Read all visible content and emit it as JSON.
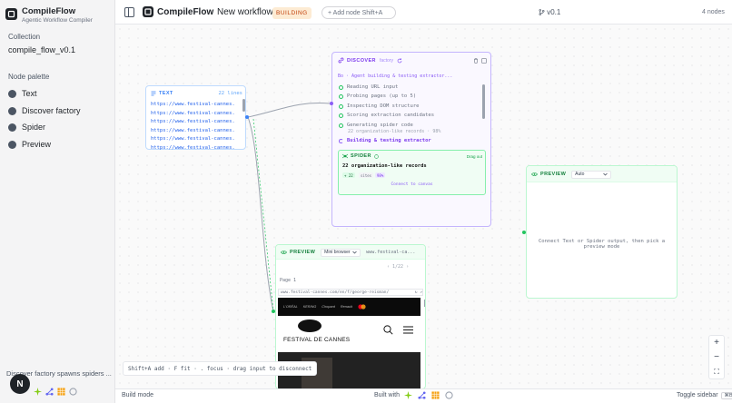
{
  "sidebar": {
    "brand_name": "CompileFlow",
    "brand_sub": "Agentic Workflow Compiler",
    "collection_label": "Collection",
    "collection_name": "compile_flow_v0.1",
    "palette_label": "Node palette",
    "palette": [
      {
        "label": "Text"
      },
      {
        "label": "Discover factory"
      },
      {
        "label": "Spider"
      },
      {
        "label": "Preview"
      }
    ],
    "hint": "Discover factory spawns spiders ...",
    "avatar_letter": "N"
  },
  "topbar": {
    "app_title": "CompileFlow",
    "workflow_name": "New workflow",
    "status": "BUILDING",
    "add_node": "+ Add node  Shift+A",
    "version": "v0.1",
    "node_count": "4 nodes"
  },
  "text_node": {
    "tag": "TEXT",
    "count": "22 lines",
    "urls": [
      "https://www.festival-cannes.c...",
      "https://www.festival-cannes.c...",
      "https://www.festival-cannes.c...",
      "https://www.festival-cannes.c...",
      "https://www.festival-cannes.c...",
      "https://www.festival-cannes.c..."
    ]
  },
  "discover_node": {
    "tag": "DISCOVER",
    "kind": "factory",
    "subtitle": "Bo · Agent building & testing extractor...",
    "steps": [
      "Reading URL input",
      "Probing pages (up to 5)",
      "Inspecting DOM structure",
      "Scoring extraction candidates",
      "Generating spider code"
    ],
    "step_sub": "22 organization-like records · 98%",
    "active_step": "Building & testing extractor",
    "spider": {
      "tag": "SPIDER",
      "drag": "Drag out",
      "title": "22 organization-like records",
      "chips": [
        "+ 22",
        "sites",
        "98%"
      ],
      "connect": "Connect to canvas"
    }
  },
  "preview_right": {
    "tag": "PREVIEW",
    "mode": "Auto",
    "hint": "Connect Text or Spider output, then pick a preview mode"
  },
  "preview_bottom": {
    "tag": "PREVIEW",
    "mode": "Mini browser",
    "url_short": "www.festival-ca...",
    "pager": "1/22",
    "page": "Page 1",
    "address": "www.festival-cannes.com/en/f/george-reisman/",
    "site_name": "FESTIVAL DE CANNES",
    "sponsors": [
      "L'ORÉAL",
      "KERING",
      "Chopard",
      "Renault",
      "Mastercard"
    ]
  },
  "canvas": {
    "hint": "Shift+A add · F fit · . focus · drag input to disconnect"
  },
  "zoom": {
    "plus": "+",
    "minus": "−",
    "fit": "⛶"
  },
  "statusbar": {
    "mode": "Build mode",
    "built_with": "Built with",
    "toggle": "Toggle sidebar",
    "toggle_kbd": "⌘B"
  },
  "colors": {
    "accent_purple": "#7c3aed",
    "accent_green": "#15803d",
    "accent_blue": "#3b82f6",
    "status_orange": "#c2410c"
  }
}
